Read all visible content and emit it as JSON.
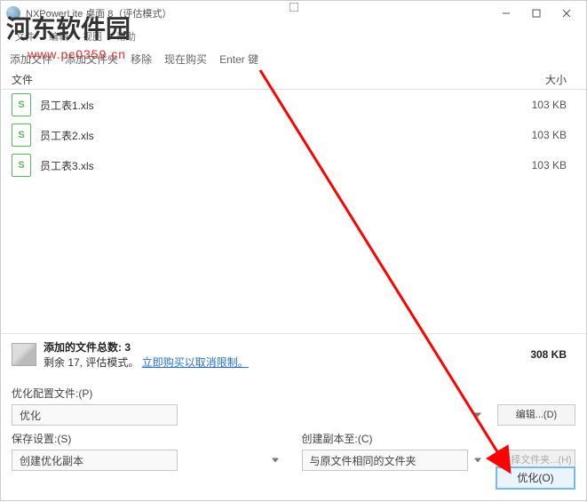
{
  "titlebar": {
    "title": "NXPowerLite 桌面 8（评估模式）"
  },
  "menubar": {
    "items": [
      "文件",
      "编辑",
      "视图",
      "帮助"
    ]
  },
  "toolbar": {
    "add_files": "添加文件",
    "add_folder": "添加文件夹",
    "remove": "移除",
    "now_buy": "现在购买",
    "enter_key": "Enter 键"
  },
  "columns": {
    "name": "文件",
    "size": "大小"
  },
  "files": [
    {
      "name": "员工表1.xls",
      "size": "103 KB"
    },
    {
      "name": "员工表2.xls",
      "size": "103 KB"
    },
    {
      "name": "员工表3.xls",
      "size": "103 KB"
    }
  ],
  "summary": {
    "count_label": "添加的文件总数: 3",
    "remain_prefix": "剩余 17, 评估模式。",
    "buy_link": "立即购买以取消限制。",
    "total_size": "308 KB"
  },
  "config": {
    "profile_label": "优化配置文件:(P)",
    "profile_value": "优化",
    "edit_btn": "编辑...(D)",
    "save_label": "保存设置:(S)",
    "save_value": "创建优化副本",
    "copy_label": "创建副本至:(C)",
    "copy_value": "与原文件相同的文件夹",
    "choose_btn": "选择文件夹...(H)"
  },
  "optimize_btn": "优化(O)",
  "watermark": {
    "text": "河东软件园",
    "url": "www.pc0359.cn"
  }
}
